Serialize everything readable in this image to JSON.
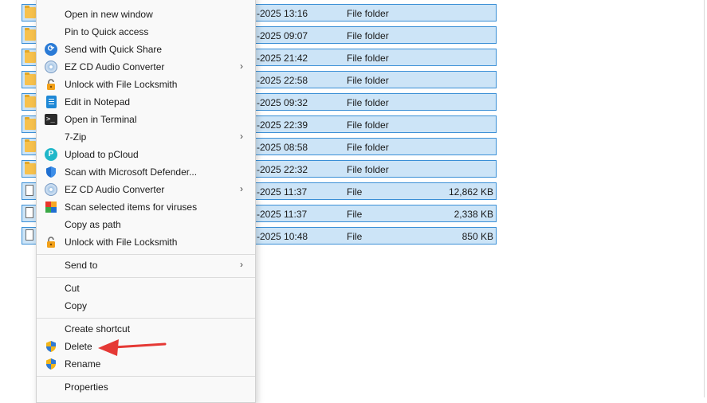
{
  "file_rows": [
    {
      "date": "-2025 13:16",
      "type": "File folder",
      "size": "",
      "kind": "folder"
    },
    {
      "date": "-2025 09:07",
      "type": "File folder",
      "size": "",
      "kind": "folder"
    },
    {
      "date": "-2025 21:42",
      "type": "File folder",
      "size": "",
      "kind": "folder"
    },
    {
      "date": "-2025 22:58",
      "type": "File folder",
      "size": "",
      "kind": "folder"
    },
    {
      "date": "-2025 09:32",
      "type": "File folder",
      "size": "",
      "kind": "folder"
    },
    {
      "date": "-2025 22:39",
      "type": "File folder",
      "size": "",
      "kind": "folder"
    },
    {
      "date": "-2025 08:58",
      "type": "File folder",
      "size": "",
      "kind": "folder"
    },
    {
      "date": "-2025 22:32",
      "type": "File folder",
      "size": "",
      "kind": "folder"
    },
    {
      "date": "-2025 11:37",
      "type": "File",
      "size": "12,862 KB",
      "kind": "file"
    },
    {
      "date": "-2025 11:37",
      "type": "File",
      "size": "2,338 KB",
      "kind": "file"
    },
    {
      "date": "-2025 10:48",
      "type": "File",
      "size": "850 KB",
      "kind": "file"
    }
  ],
  "menu": {
    "open_new_window": "Open in new window",
    "pin_quick_access": "Pin to Quick access",
    "send_quick_share": "Send with Quick Share",
    "ez_cd_1": "EZ CD Audio Converter",
    "unlock_locksmith_1": "Unlock with File Locksmith",
    "edit_notepad": "Edit in Notepad",
    "open_terminal": "Open in Terminal",
    "seven_zip": "7-Zip",
    "upload_pcloud": "Upload to pCloud",
    "scan_defender": "Scan with Microsoft Defender...",
    "ez_cd_2": "EZ CD Audio Converter",
    "scan_viruses": "Scan selected items for viruses",
    "copy_path": "Copy as path",
    "unlock_locksmith_2": "Unlock with File Locksmith",
    "send_to": "Send to",
    "cut": "Cut",
    "copy": "Copy",
    "create_shortcut": "Create shortcut",
    "delete": "Delete",
    "rename": "Rename",
    "properties": "Properties",
    "chevron": "›"
  },
  "icons": {
    "quick_share_glyph": "⟳",
    "pcloud_glyph": "P",
    "terminal_glyph": ">_"
  },
  "colors": {
    "selection_fill": "#cce4f7",
    "selection_border": "#3a8fd6",
    "annotation_arrow": "#e53935"
  }
}
